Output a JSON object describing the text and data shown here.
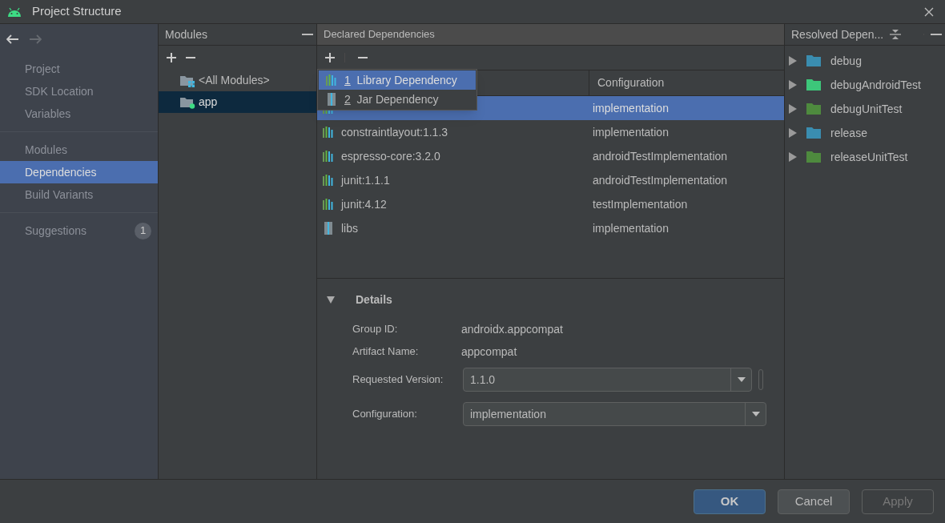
{
  "window": {
    "title": "Project Structure"
  },
  "sidebar": {
    "groups": [
      [
        {
          "label": "Project",
          "selected": false
        },
        {
          "label": "SDK Location",
          "selected": false
        },
        {
          "label": "Variables",
          "selected": false
        }
      ],
      [
        {
          "label": "Modules",
          "selected": false
        },
        {
          "label": "Dependencies",
          "selected": true
        },
        {
          "label": "Build Variants",
          "selected": false
        }
      ],
      [
        {
          "label": "Suggestions",
          "selected": false,
          "badge": "1"
        }
      ]
    ]
  },
  "modules": {
    "title": "Modules",
    "items": [
      {
        "label": "<All Modules>",
        "kind": "all",
        "selected": false
      },
      {
        "label": "app",
        "kind": "module",
        "selected": true
      }
    ]
  },
  "declared": {
    "title": "Declared Dependencies",
    "columns": [
      "Configuration"
    ],
    "rows": [
      {
        "configuration": "implementation",
        "kind": "library",
        "selected": true
      },
      {
        "name": "constraintlayout:1.1.3",
        "configuration": "implementation",
        "kind": "library",
        "selected": false
      },
      {
        "name": "espresso-core:3.2.0",
        "configuration": "androidTestImplementation",
        "kind": "library",
        "selected": false
      },
      {
        "name": "junit:1.1.1",
        "configuration": "androidTestImplementation",
        "kind": "library",
        "selected": false
      },
      {
        "name": "junit:4.12",
        "configuration": "testImplementation",
        "kind": "library",
        "selected": false
      },
      {
        "name": "libs",
        "configuration": "implementation",
        "kind": "jar",
        "selected": false
      }
    ],
    "menu": [
      {
        "key": "1",
        "label": "Library Dependency",
        "kind": "library",
        "selected": true
      },
      {
        "key": "2",
        "label": "Jar Dependency",
        "kind": "jar",
        "selected": false
      }
    ]
  },
  "details": {
    "title": "Details",
    "expanded": true,
    "group_id_label": "Group ID:",
    "group_id": "androidx.appcompat",
    "artifact_label": "Artifact Name:",
    "artifact": "appcompat",
    "version_label": "Requested Version:",
    "version": "1.1.0",
    "configuration_label": "Configuration:",
    "configuration": "implementation"
  },
  "resolved": {
    "title": "Resolved Depen...",
    "items": [
      {
        "label": "debug",
        "color": "#3a8db0",
        "expanded": false
      },
      {
        "label": "debugAndroidTest",
        "color": "#3dc77a",
        "expanded": false
      },
      {
        "label": "debugUnitTest",
        "color": "#4e8a3e",
        "expanded": false
      },
      {
        "label": "release",
        "color": "#3a8db0",
        "expanded": false
      },
      {
        "label": "releaseUnitTest",
        "color": "#4e8a3e",
        "expanded": false
      }
    ]
  },
  "buttons": [
    {
      "label": "OK",
      "kind": "primary"
    },
    {
      "label": "Cancel",
      "kind": "normal"
    },
    {
      "label": "Apply",
      "kind": "disabled"
    }
  ]
}
